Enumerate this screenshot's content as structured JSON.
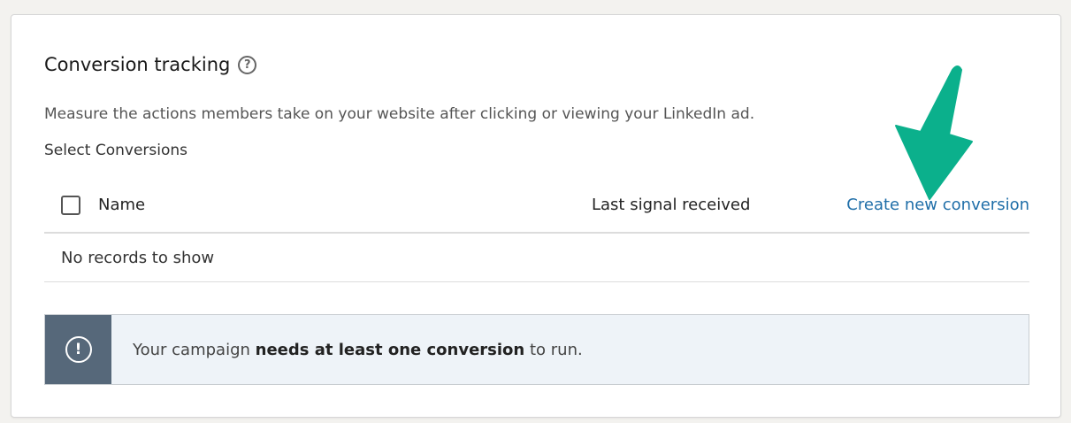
{
  "section": {
    "title": "Conversion tracking",
    "description": "Measure the actions members take on your website after clicking or viewing your LinkedIn ad.",
    "subheading": "Select Conversions"
  },
  "table": {
    "columns": [
      "Name",
      "Last signal received"
    ],
    "create_link": "Create new conversion",
    "empty_text": "No records to show"
  },
  "alert": {
    "prefix": "Your campaign ",
    "bold": "needs at least one conversion",
    "suffix": " to run.",
    "icon": "exclamation-circle-icon"
  },
  "annotation": {
    "arrow_color": "#0bb08c",
    "link_color": "#1f6ea8",
    "alert_side_color": "#56687a"
  },
  "icons": {
    "help": "question-circle-icon"
  }
}
